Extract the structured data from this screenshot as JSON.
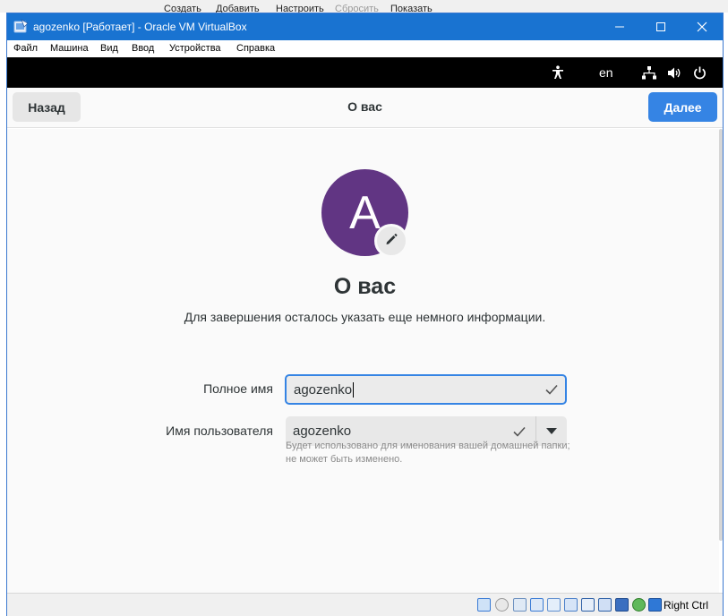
{
  "host_toolbar": {
    "create": "Создать",
    "add": "Добавить",
    "configure": "Настроить",
    "reset": "Сбросить",
    "show": "Показать"
  },
  "window": {
    "title": "agozenko [Работает] - Oracle VM VirtualBox",
    "menu": [
      "Файл",
      "Машина",
      "Вид",
      "Ввод",
      "Устройства",
      "Справка"
    ]
  },
  "gnome_topbar": {
    "language": "en",
    "icons": [
      "accessibility-icon",
      "network-icon",
      "volume-icon",
      "power-icon"
    ]
  },
  "headerbar": {
    "back_label": "Назад",
    "title": "О вас",
    "next_label": "Далее"
  },
  "page": {
    "avatar_letter": "A",
    "avatar_color": "#613583",
    "heading": "О вас",
    "subtitle": "Для завершения осталось указать еще немного информации.",
    "full_name_label": "Полное имя",
    "full_name_value": "agozenko",
    "username_label": "Имя пользователя",
    "username_value": "agozenko",
    "username_hint": "Будет использовано для именования вашей домашней папки; не может быть изменено."
  },
  "statusbar": {
    "host_key": "Right Ctrl"
  },
  "colors": {
    "accent": "#3584e4",
    "titlebar": "#1973d1"
  }
}
